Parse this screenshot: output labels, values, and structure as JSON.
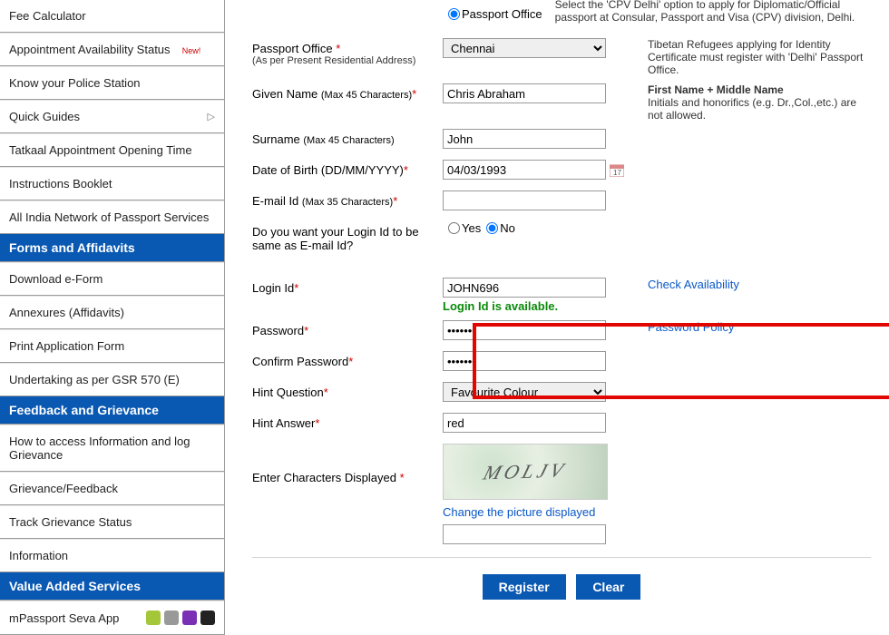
{
  "sidebar": {
    "items1": [
      {
        "label": "Fee Calculator"
      },
      {
        "label": "Appointment Availability Status",
        "badge": "New!"
      },
      {
        "label": "Know your Police Station"
      },
      {
        "label": "Quick Guides",
        "chevron": true
      },
      {
        "label": "Tatkaal Appointment Opening Time"
      },
      {
        "label": "Instructions Booklet"
      },
      {
        "label": "All India Network of Passport Services"
      }
    ],
    "header_forms": "Forms and Affidavits",
    "items2": [
      {
        "label": "Download e-Form"
      },
      {
        "label": "Annexures (Affidavits)"
      },
      {
        "label": "Print Application Form"
      },
      {
        "label": "Undertaking as per GSR 570 (E)"
      }
    ],
    "header_feedback": "Feedback and Grievance",
    "items3": [
      {
        "label": "How to access Information and log Grievance"
      },
      {
        "label": "Grievance/Feedback"
      },
      {
        "label": "Track Grievance Status"
      },
      {
        "label": "Information"
      }
    ],
    "header_value": "Value Added Services",
    "mpassport": "mPassport Seva App"
  },
  "form": {
    "register_at": {
      "passport_office_option": "Passport Office"
    },
    "passport_office": {
      "label": "Passport Office",
      "sub": "(As per Present Residential Address)",
      "value": "Chennai"
    },
    "given_name": {
      "label": "Given Name",
      "sub": "(Max 45 Characters)",
      "value": "Chris Abraham"
    },
    "surname": {
      "label": "Surname",
      "sub": "(Max 45 Characters)",
      "value": "John"
    },
    "dob": {
      "label": "Date of Birth (DD/MM/YYYY)",
      "value": "04/03/1993"
    },
    "email": {
      "label": "E-mail Id",
      "sub": "(Max 35 Characters)",
      "value": ""
    },
    "same_login": {
      "label": "Do you want your Login Id to be same as E-mail Id?",
      "yes": "Yes",
      "no": "No"
    },
    "login_id": {
      "label": "Login Id",
      "value": "JOHN696",
      "check": "Check Availability",
      "avail": "Login Id is available."
    },
    "password": {
      "label": "Password",
      "policy": "Password Policy"
    },
    "confirm": {
      "label": "Confirm Password"
    },
    "hint_q": {
      "label": "Hint Question",
      "value": "Favourite Colour"
    },
    "hint_a": {
      "label": "Hint Answer",
      "value": "red"
    },
    "captcha": {
      "label": "Enter Characters Displayed",
      "change": "Change the picture displayed",
      "text": "MOLJV",
      "value": ""
    }
  },
  "info": {
    "cpv": "Select the 'CPV Delhi' option to apply for Diplomatic/Official passport at Consular, Passport and Visa (CPV) division, Delhi.",
    "tibetan": "Tibetan Refugees applying for Identity Certificate must register with 'Delhi' Passport Office.",
    "name_rule_title": "First Name + Middle Name",
    "name_rule": "Initials and honorifics (e.g. Dr.,Col.,etc.) are not allowed."
  },
  "buttons": {
    "register": "Register",
    "clear": "Clear"
  }
}
